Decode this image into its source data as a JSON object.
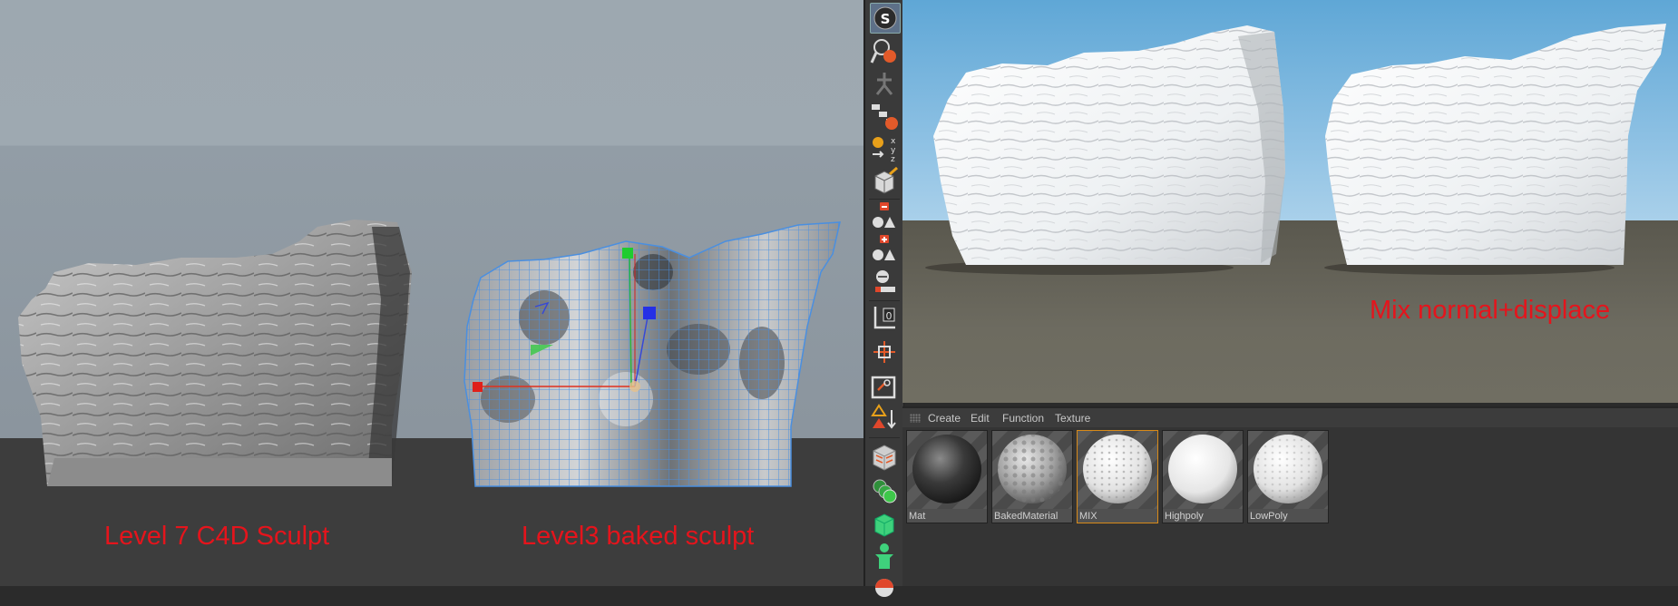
{
  "left_viewport": {
    "caption_left": "Level 7 C4D Sculpt",
    "caption_right": "Level3 baked sculpt"
  },
  "right_viewport": {
    "caption": "Mix normal+displace"
  },
  "toolbar": {
    "icons": [
      "scale-icon",
      "magnify-icon",
      "pose-icon",
      "hierarchy-icon",
      "coordinate-icon",
      "cube-paint-icon",
      "subdivide-down-icon",
      "subdivide-up-icon",
      "subdivide-icon",
      "axis-icon",
      "snap-icon",
      "workplane-icon",
      "triangle-arrow-icon",
      "cube-icon",
      "spheres-icon",
      "green-cube-icon",
      "figure-icon",
      "half-circle-icon"
    ],
    "scale_letter": "S",
    "axis_letter": "0"
  },
  "material_manager": {
    "menu": [
      "Create",
      "Edit",
      "Function",
      "Texture"
    ],
    "materials": [
      {
        "name": "Mat",
        "selected": false
      },
      {
        "name": "BakedMaterial",
        "selected": false
      },
      {
        "name": "MIX",
        "selected": true
      },
      {
        "name": "Highpoly",
        "selected": false
      },
      {
        "name": "LowPoly",
        "selected": false
      }
    ]
  },
  "colors": {
    "caption_red": "#e5141c",
    "selection_orange": "#d88a19",
    "wireframe_blue": "#4a8fe0"
  }
}
